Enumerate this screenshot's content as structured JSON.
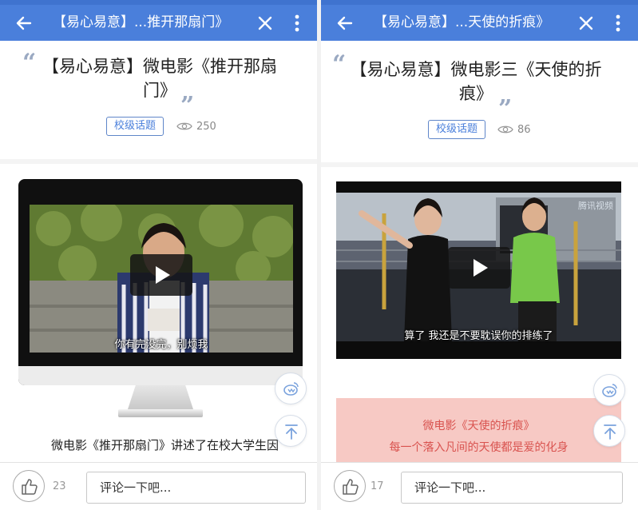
{
  "colors": {
    "appbar": "#4a7fdb",
    "accent": "#4a7fdb",
    "promo_bg": "#f7c9c4",
    "promo_text": "#d9534f"
  },
  "panel1": {
    "appbar": {
      "title": "【易心易意】...推开那扇门》",
      "back_icon": "arrow-left-icon",
      "close_icon": "close-icon",
      "more_icon": "more-vertical-icon"
    },
    "title_line1": "【易心易意】微电影《推开那扇",
    "title_line2": "门》",
    "tag": "校级话题",
    "views": "250",
    "video": {
      "subtitle": "你有完没完，别烦我"
    },
    "description": "微电影《推开那扇门》讲述了在校大学生因",
    "likes": "23",
    "comment_placeholder": "评论一下吧..."
  },
  "panel2": {
    "appbar": {
      "title": "【易心易意】...天使的折痕》",
      "back_icon": "arrow-left-icon",
      "close_icon": "close-icon",
      "more_icon": "more-vertical-icon"
    },
    "title_line1": "【易心易意】微电影三《天使的折",
    "title_line2": "痕》",
    "tag": "校级话题",
    "views": "86",
    "video": {
      "subtitle": "算了 我还是不要耽误你的排练了",
      "watermark": "腾讯视频"
    },
    "promo_line1": "微电影《天使的折痕》",
    "promo_line2": "每一个落入凡间的天使都是爱的化身",
    "likes": "17",
    "comment_placeholder": "评论一下吧..."
  }
}
